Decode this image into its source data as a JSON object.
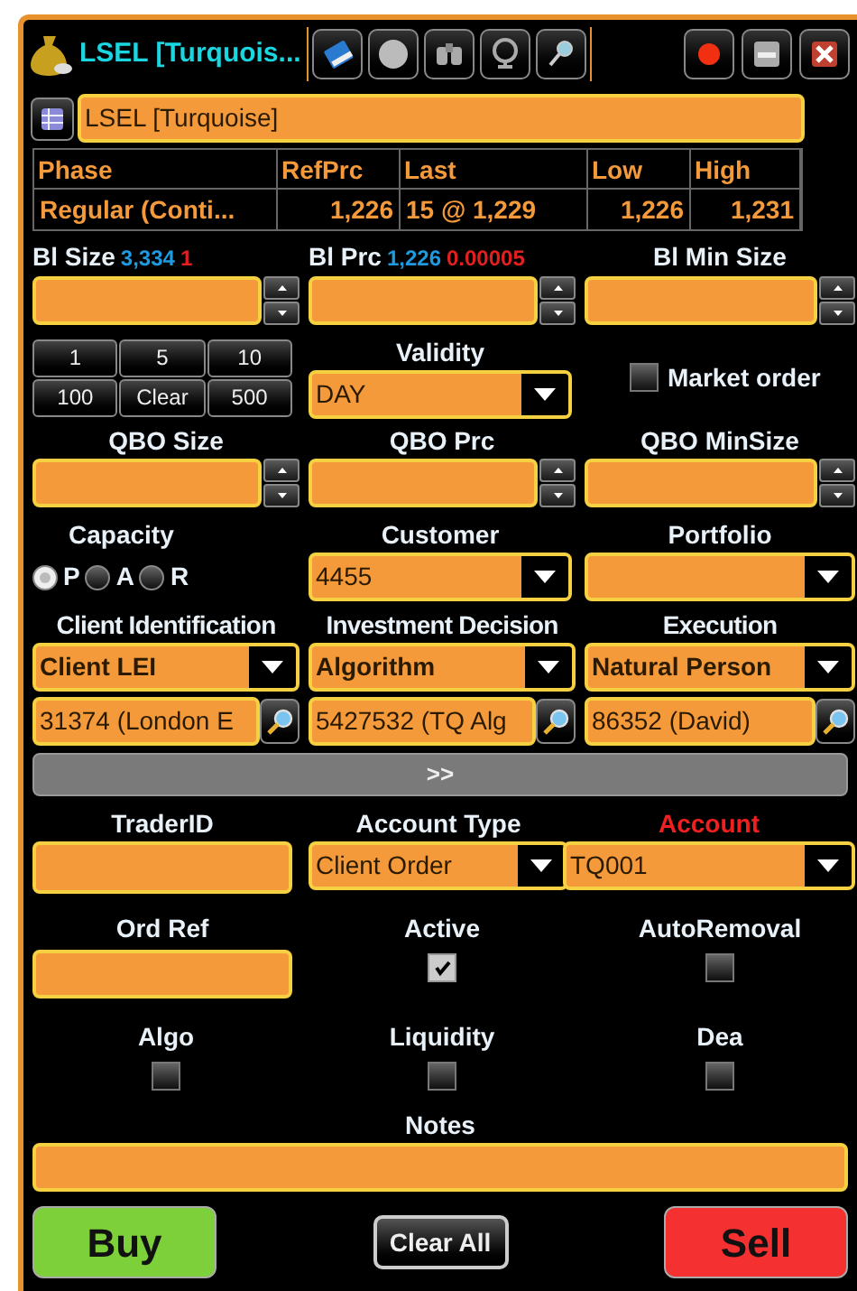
{
  "window": {
    "title": "LSEL [Turquois..."
  },
  "instrument": "LSEL [Turquoise]",
  "market_table": {
    "columns": [
      "Phase",
      "RefPrc",
      "Last",
      "Low",
      "High"
    ],
    "rows": [
      [
        "Regular (Conti...",
        "1,226",
        "15 @ 1,229",
        "1,226",
        "1,231"
      ]
    ]
  },
  "bid_fields": [
    {
      "label": "Bl Size",
      "info": [
        {
          "text": "3,334",
          "color": "#1e9be0"
        },
        {
          "text": "1",
          "color": "#e02020"
        }
      ]
    },
    {
      "label": "Bl Prc",
      "info": [
        {
          "text": "1,226",
          "color": "#1e9be0"
        },
        {
          "text": "0.00005",
          "color": "#e02020"
        }
      ]
    },
    {
      "label": "Bl Min Size"
    }
  ],
  "quick_sizes": [
    "1",
    "5",
    "10",
    "100",
    "Clear",
    "500"
  ],
  "validity": {
    "label": "Validity",
    "value": "DAY"
  },
  "market_order": {
    "label": "Market order",
    "checked": false
  },
  "qbo_fields": [
    {
      "label": "QBO Size"
    },
    {
      "label": "QBO Prc"
    },
    {
      "label": "QBO MinSize"
    }
  ],
  "capacity": {
    "label": "Capacity",
    "options": [
      {
        "label": "P",
        "selected": true
      },
      {
        "label": "A",
        "selected": false
      },
      {
        "label": "R",
        "selected": false
      }
    ]
  },
  "customer": {
    "label": "Customer",
    "value": "4455"
  },
  "portfolio": {
    "label": "Portfolio"
  },
  "identification": [
    {
      "label": "Client Identification",
      "type": "Client LEI",
      "value": "31374 (London E"
    },
    {
      "label": "Investment Decision",
      "type": "Algorithm",
      "value": "5427532 (TQ Alg"
    },
    {
      "label": "Execution",
      "type": "Natural Person",
      "value": "86352 (David)"
    }
  ],
  "expand_button": ">>",
  "trader_id": {
    "label": "TraderID"
  },
  "account_type": {
    "label": "Account Type",
    "value": "Client Order"
  },
  "account": {
    "label": "Account",
    "value": "TQ001",
    "required": true
  },
  "ord_ref": {
    "label": "Ord Ref"
  },
  "flags": [
    {
      "label": "Active",
      "checked": true
    },
    {
      "label": "AutoRemoval",
      "checked": false
    },
    {
      "label": "Algo",
      "checked": false
    },
    {
      "label": "Liquidity",
      "checked": false
    },
    {
      "label": "Dea",
      "checked": false
    }
  ],
  "notes": {
    "label": "Notes"
  },
  "buttons": [
    {
      "label": "Buy",
      "kind": "buy"
    },
    {
      "label": "Clear All",
      "kind": "clear"
    },
    {
      "label": "Sell",
      "kind": "sell"
    }
  ]
}
